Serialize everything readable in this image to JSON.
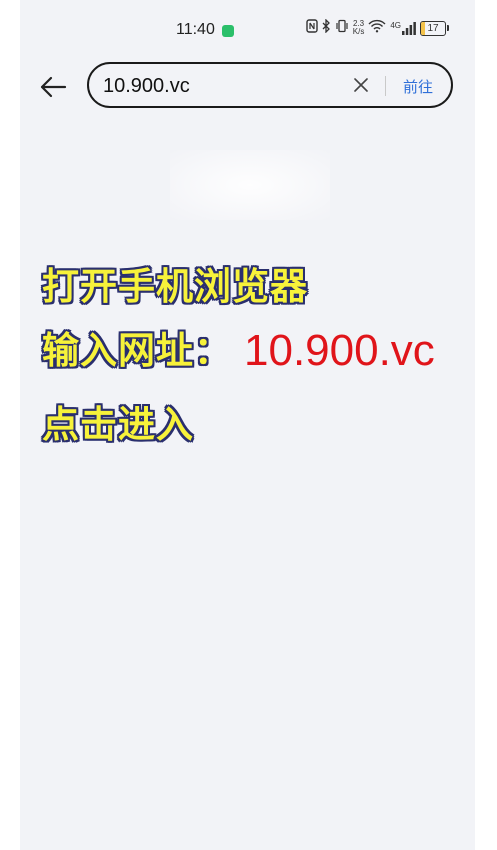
{
  "status_bar": {
    "time": "11:40",
    "net_speed_top": "2.3",
    "net_speed_bottom": "K/s",
    "network_type": "4G",
    "battery": "17",
    "battery_level_percent": 17
  },
  "browser": {
    "url": "10.900.vc",
    "go_label": "前往"
  },
  "overlay": {
    "line1": "打开手机浏览器",
    "line2_prefix": "输入网址：",
    "line2_url": "10.900.vc",
    "line3": "点击进入"
  },
  "colors": {
    "overlay_text": "#f7f23a",
    "url_highlight": "#e0141a",
    "go_link": "#2f6fd8",
    "background": "#f2f3f7"
  }
}
